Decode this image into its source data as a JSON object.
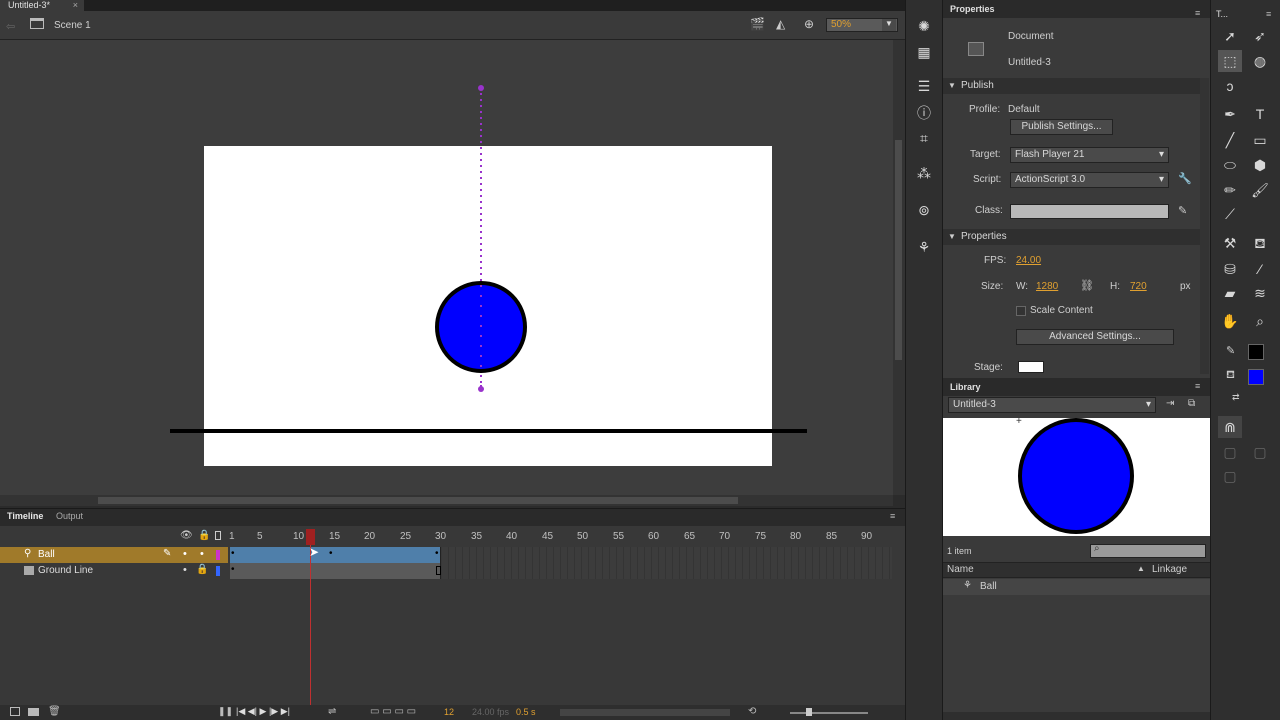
{
  "document_tab": {
    "title": "Untitled-3*",
    "close": "×"
  },
  "scene": {
    "label": "Scene 1",
    "zoom": "50%"
  },
  "timeline": {
    "tabs": [
      "Timeline",
      "Output"
    ],
    "ruler": [
      "1",
      "5",
      "10",
      "15",
      "20",
      "25",
      "30",
      "35",
      "40",
      "45",
      "50",
      "55",
      "60",
      "65",
      "70",
      "75",
      "80",
      "85",
      "90"
    ],
    "layers": [
      {
        "name": "Ball"
      },
      {
        "name": "Ground Line"
      }
    ],
    "current_frame": "12",
    "fps": "24.00 fps",
    "elapsed": "0.5 s"
  },
  "properties": {
    "title": "Properties",
    "doc_type": "Document",
    "doc_name": "Untitled-3",
    "publish_section": "Publish",
    "profile_label": "Profile:",
    "profile_value": "Default",
    "publish_settings_btn": "Publish Settings...",
    "target_label": "Target:",
    "target_value": "Flash Player 21",
    "script_label": "Script:",
    "script_value": "ActionScript 3.0",
    "class_label": "Class:",
    "properties_section": "Properties",
    "fps_label": "FPS:",
    "fps_value": "24.00",
    "size_label": "Size:",
    "w_label": "W:",
    "w_value": "1280",
    "h_label": "H:",
    "h_value": "720",
    "unit": "px",
    "scale_content": "Scale Content",
    "advanced_btn": "Advanced Settings...",
    "stage_label": "Stage:"
  },
  "library": {
    "title": "Library",
    "doc_select": "Untitled-3",
    "count": "1 item",
    "col_name": "Name",
    "col_linkage": "Linkage",
    "items": [
      {
        "name": "Ball"
      }
    ]
  },
  "tools_panel": {
    "title": "T..."
  },
  "colors": {
    "ball": "#0000ff",
    "guide": "#9933cc",
    "accent": "#e0a030",
    "layer_highlight": "#a07a2a"
  }
}
